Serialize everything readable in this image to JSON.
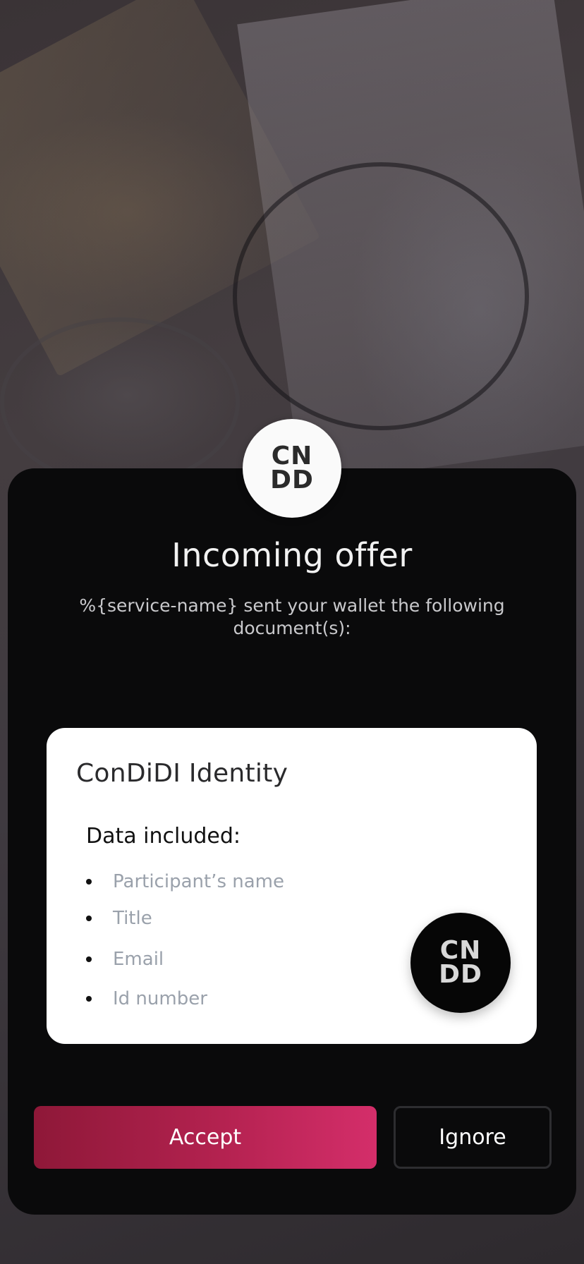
{
  "offer": {
    "title": "Incoming offer",
    "subtitle": "%{service-name} sent your wallet the following document(s):",
    "logo_top_line": "CN",
    "logo_bottom_line": "DD"
  },
  "document_card": {
    "title": "ConDiDI Identity",
    "data_heading": "Data included:",
    "items": [
      "Participant’s name",
      "Title",
      "Email",
      "Id number"
    ],
    "logo_top_line": "CN",
    "logo_bottom_line": "DD"
  },
  "actions": {
    "accept_label": "Accept",
    "ignore_label": "Ignore"
  },
  "icons": {
    "top_logo": "condidi-logo-icon",
    "card_logo": "condidi-logo-icon"
  },
  "colors": {
    "accent_start": "#8e1838",
    "accent_end": "#d42e6a",
    "sheet_background": "#0a0a0b"
  }
}
